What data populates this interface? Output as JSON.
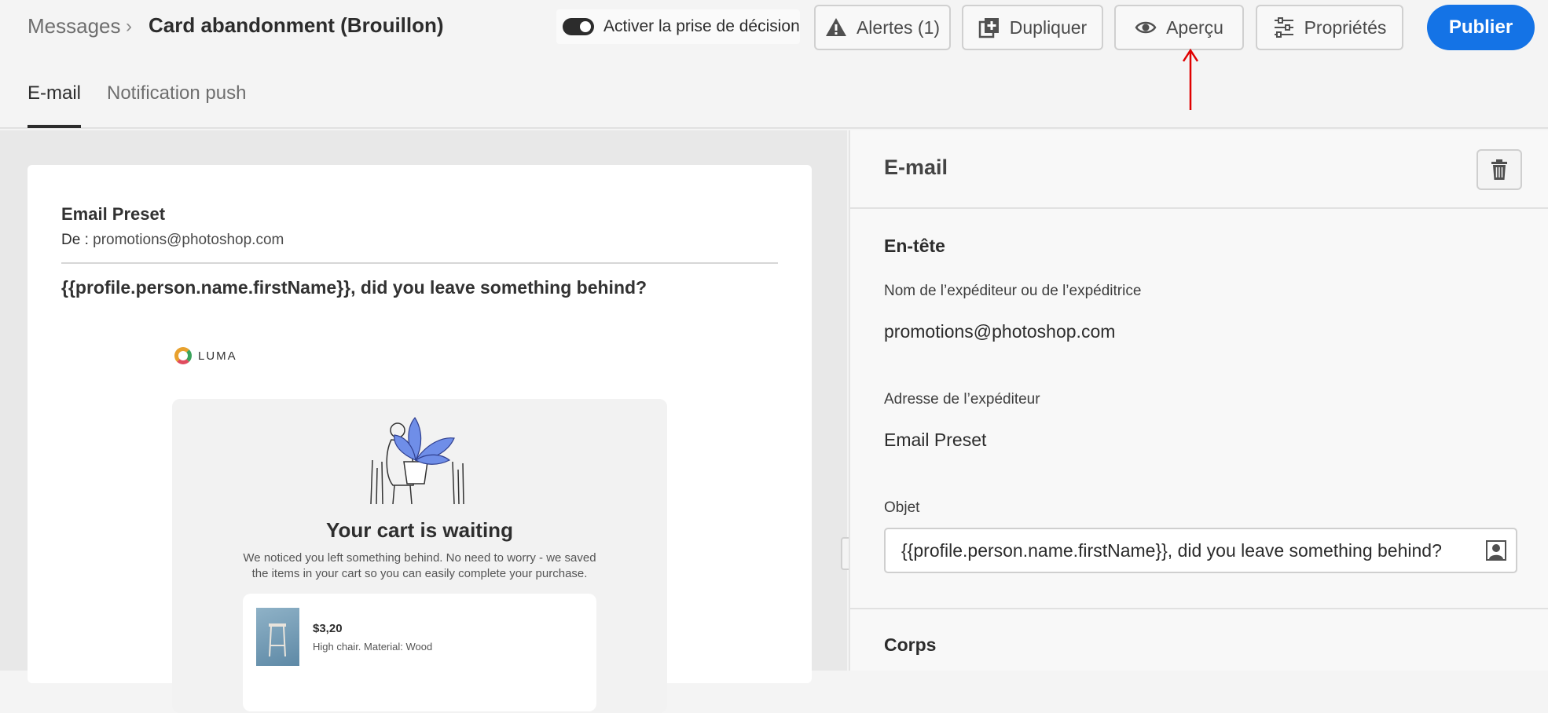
{
  "breadcrumb": {
    "root": "Messages",
    "separator": "›",
    "title": "Card abandonment (Brouillon)"
  },
  "toolbar": {
    "decision_toggle_label": "Activer la prise de décision",
    "decision_toggle_on": true,
    "alerts_label": "Alertes (1)",
    "duplicate_label": "Dupliquer",
    "preview_label": "Aperçu",
    "properties_label": "Propriétés",
    "publish_label": "Publier"
  },
  "tabs": [
    {
      "label": "E-mail",
      "active": true
    },
    {
      "label": "Notification push",
      "active": false
    }
  ],
  "email_preview": {
    "sender_name": "Email Preset",
    "from_prefix": "De :",
    "from_address": "promotions@photoshop.com",
    "subject": "{{profile.person.name.firstName}}, did you leave something behind?",
    "brand": "LUMA",
    "cart_title": "Your cart is waiting",
    "cart_text": "We noticed you left something behind. No need to worry - we saved the items in your cart so you can easily complete your purchase.",
    "product": {
      "price": "$3,20",
      "description": "High chair. Material: Wood"
    }
  },
  "panel": {
    "title": "E-mail",
    "header_section": "En-tête",
    "sender_name_label": "Nom de l’expéditeur ou de l’expéditrice",
    "sender_name_value": "promotions@photoshop.com",
    "sender_address_label": "Adresse de l’expéditeur",
    "sender_address_value": "Email Preset",
    "subject_label": "Objet",
    "subject_value": "{{profile.person.name.firstName}}, did you leave something behind?",
    "body_section": "Corps"
  },
  "colors": {
    "accent": "#1473e6",
    "annotation": "#e00000"
  }
}
